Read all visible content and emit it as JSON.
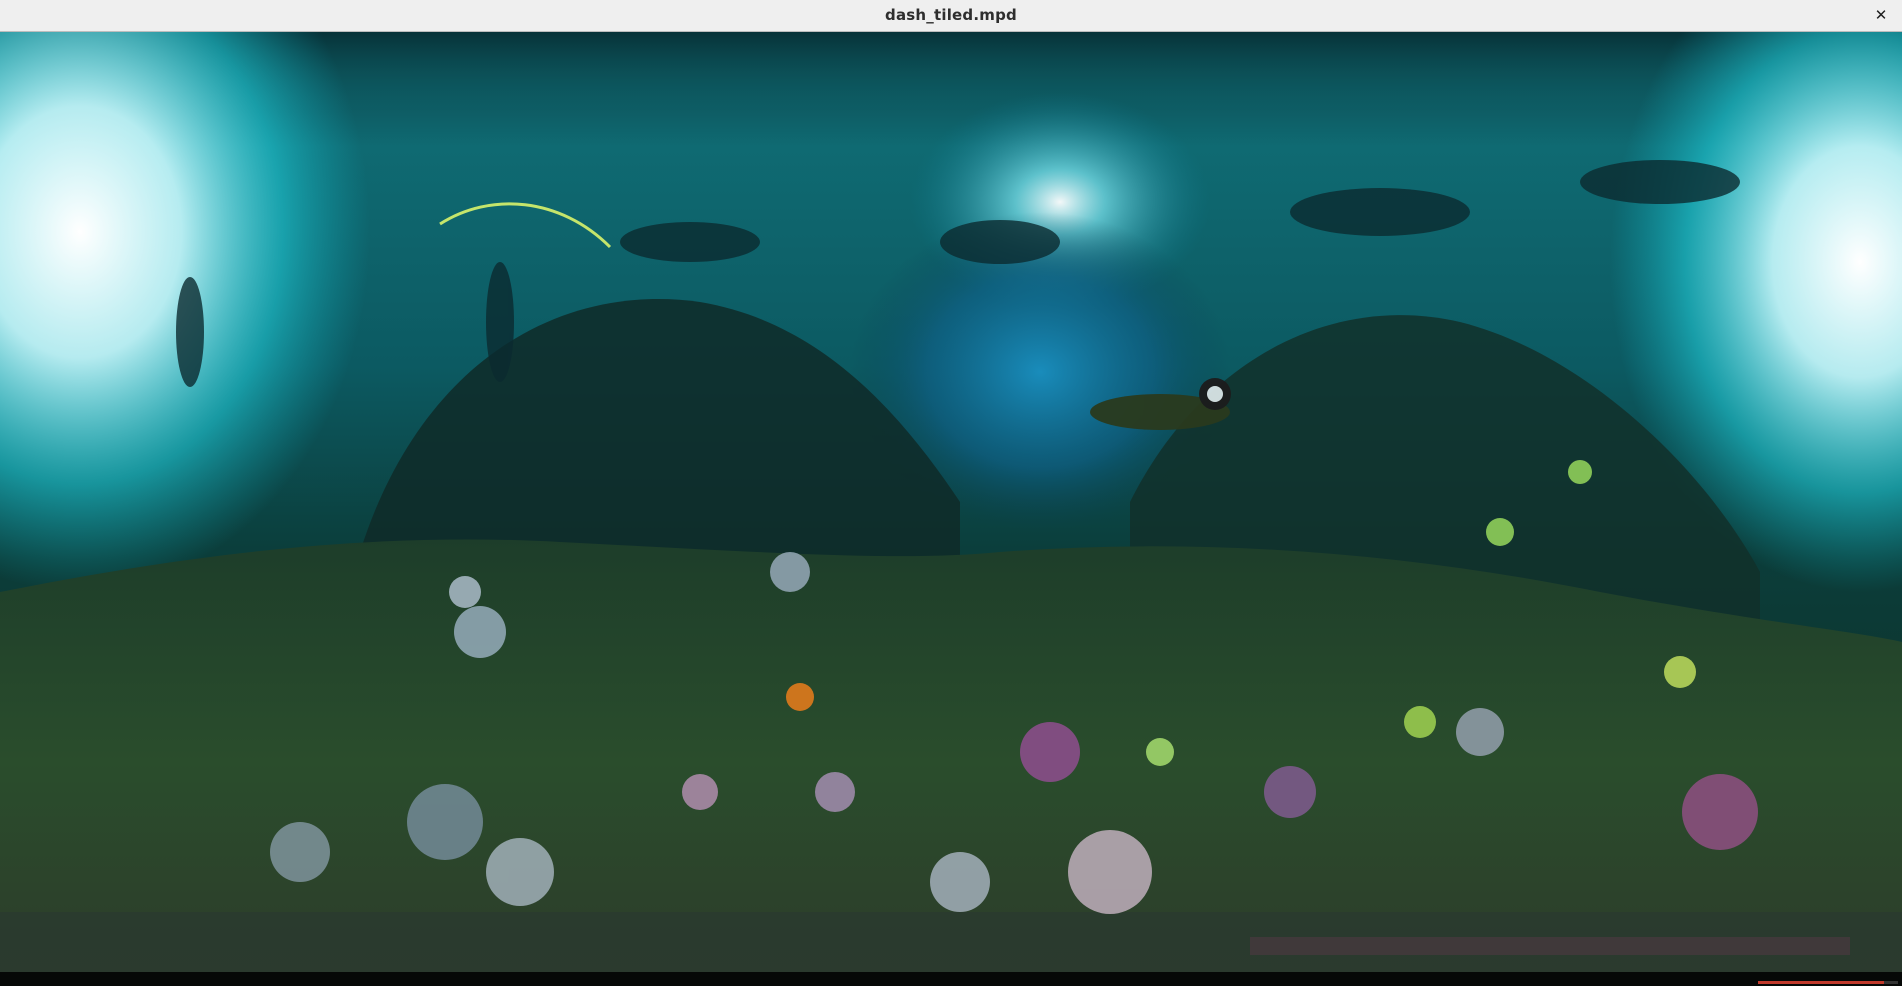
{
  "window": {
    "title": "dash_tiled.mpd",
    "close_glyph": "✕",
    "close_icon": "close-icon"
  },
  "player": {
    "content": "360-degree equirectangular underwater scene: free divers and snorkelers near the surface, coral reef with soft corals on the seabed",
    "status_text": "",
    "playback_progress": 0.9,
    "colors": {
      "titlebar_bg": "#efefef",
      "water_top": "#0e6f78",
      "water_mid": "#0a4c55",
      "glow": "#dff9ff",
      "reef": "#1f4a2c",
      "progress": "#c0392b"
    }
  }
}
